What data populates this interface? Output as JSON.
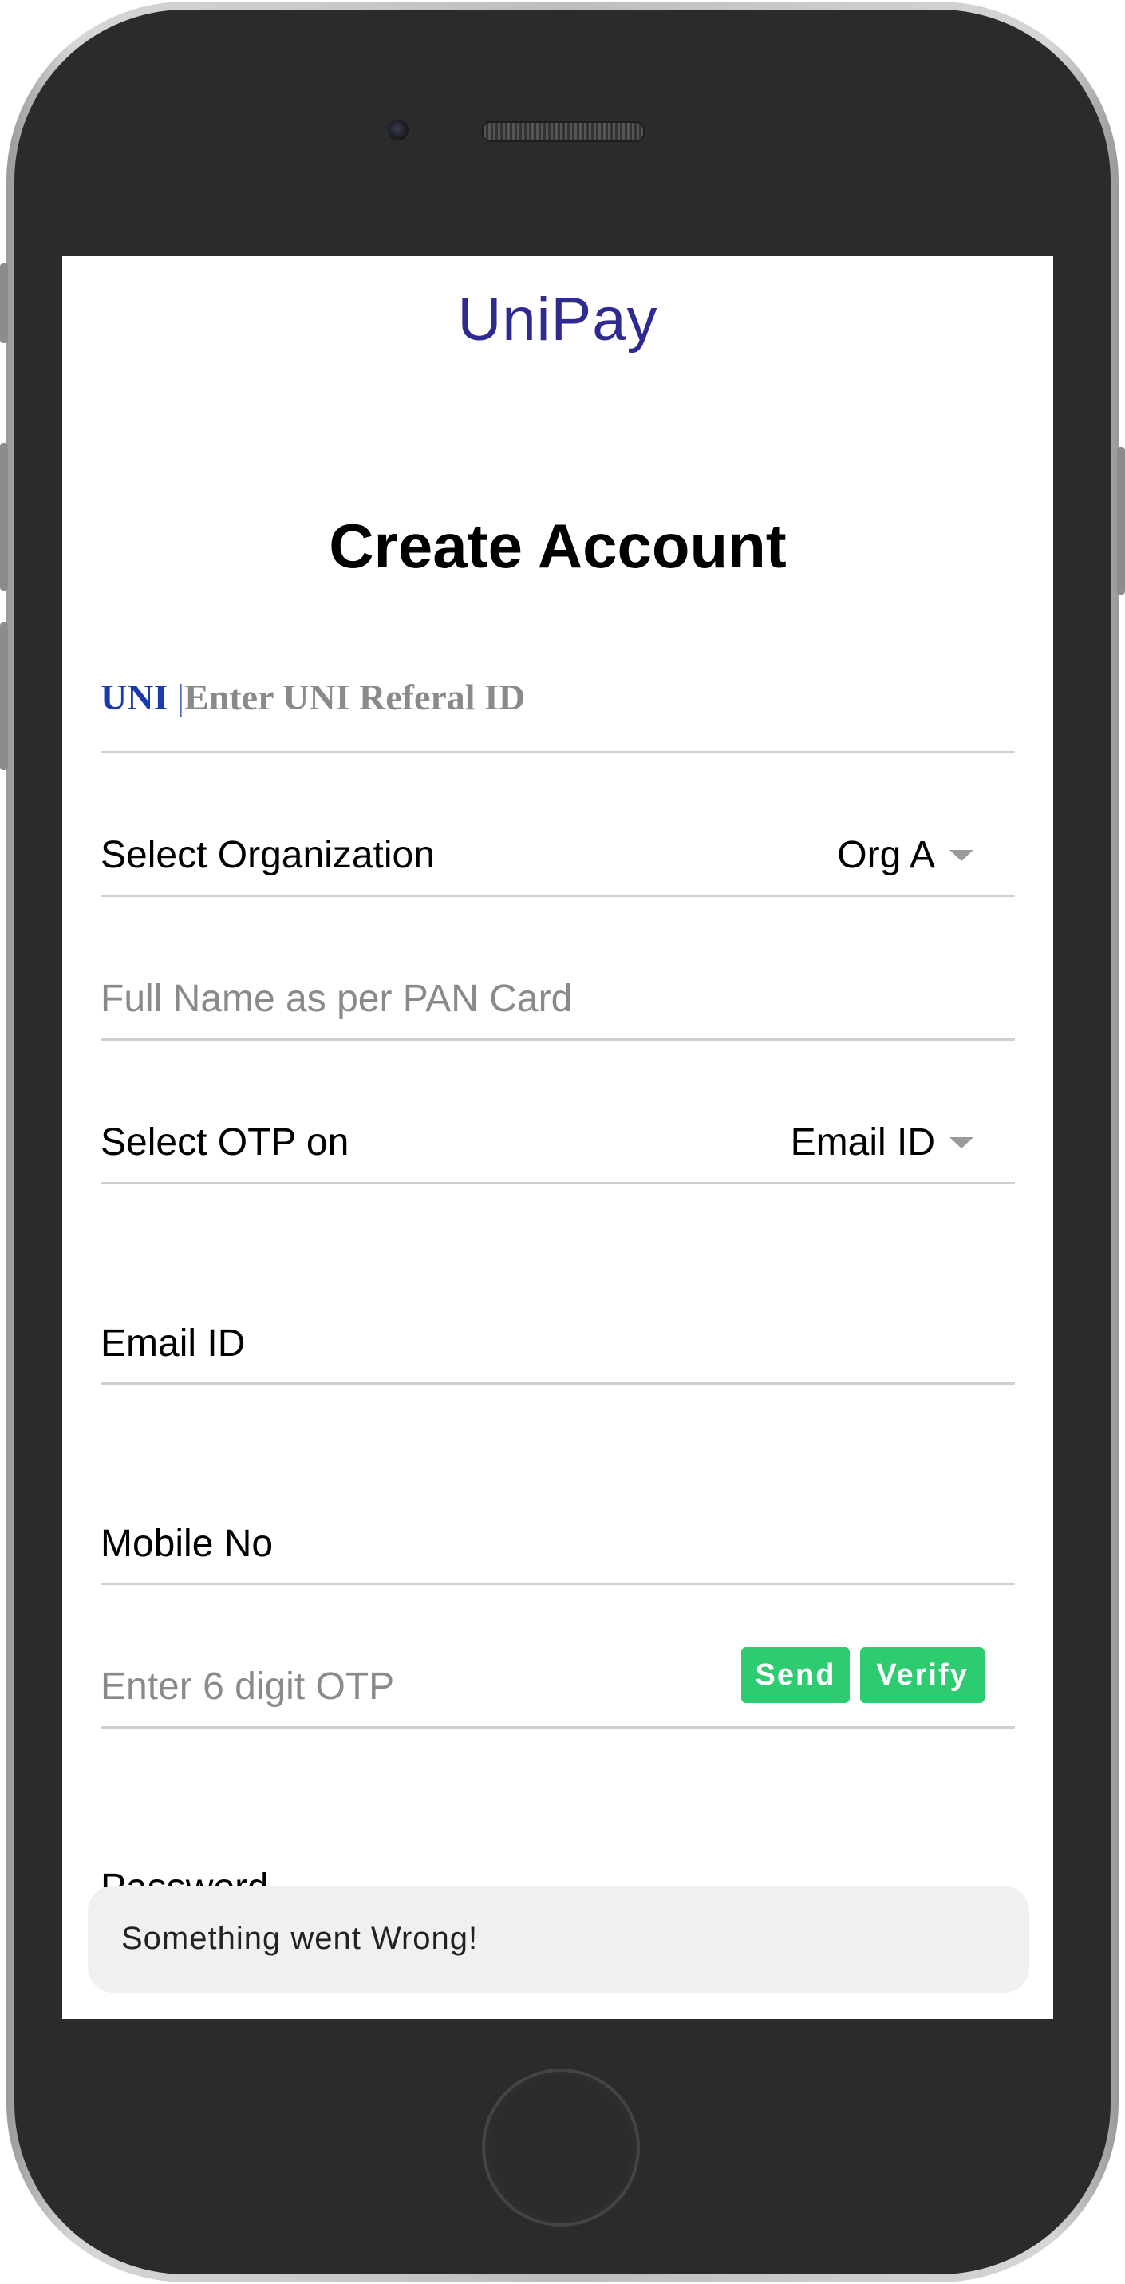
{
  "app": {
    "brand": "UniPay"
  },
  "page": {
    "title": "Create Account"
  },
  "form": {
    "referral": {
      "prefix": "UNI",
      "separator": "|",
      "placeholder": "Enter UNI Referal ID"
    },
    "organization": {
      "label": "Select Organization",
      "value": "Org A"
    },
    "full_name": {
      "placeholder": "Full Name as per PAN Card"
    },
    "otp_on": {
      "label": "Select OTP on",
      "value": "Email ID"
    },
    "email": {
      "label": "Email ID"
    },
    "mobile": {
      "label": "Mobile No"
    },
    "otp": {
      "placeholder": "Enter 6 digit OTP",
      "send_label": "Send",
      "verify_label": "Verify"
    },
    "password": {
      "label": "Password"
    }
  },
  "toast": {
    "message": "Something went Wrong!"
  },
  "colors": {
    "brand": "#2e2a8f",
    "accent_button": "#2ecc71",
    "referral_prefix": "#1a3bb0"
  },
  "icons": {
    "dropdown": "caret-down-icon"
  }
}
